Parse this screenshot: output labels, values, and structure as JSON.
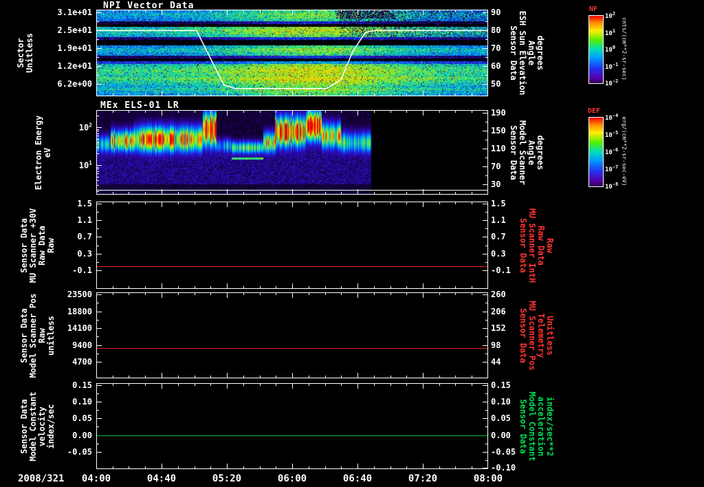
{
  "chart_data": {
    "type": "multi-panel-time-series",
    "time_axis": {
      "date_label": "2008/321",
      "start_hour": 4.0,
      "end_hour": 8.0,
      "tick_labels": [
        "04:00",
        "04:40",
        "05:20",
        "06:00",
        "06:40",
        "07:20",
        "08:00"
      ],
      "tick_hours": [
        4.0,
        4.6667,
        5.3333,
        6.0,
        6.6667,
        7.3333,
        8.0
      ],
      "minor_tick_minutes": 10
    },
    "panels": [
      {
        "id": "npi-vector",
        "type": "heatmap",
        "title": "NPI Vector Data",
        "y_left": {
          "label_lines": [
            "Sector",
            "Unitless"
          ],
          "tick_labels": [
            "3.1e+01",
            "2.5e+01",
            "1.9e+01",
            "1.2e+01",
            "6.2e+00"
          ]
        },
        "y_right": {
          "label_lines": [
            "Sensor Data",
            "ESH Sun Elevation",
            "Angle",
            "degrees"
          ],
          "ticks": [
            90,
            80,
            70,
            60,
            50
          ],
          "vmax": 91.5,
          "vmin": 43.0
        },
        "overlay_line": {
          "name": "sun-elevation-angle",
          "color": "#ffffff",
          "points": [
            [
              4.0,
              80
            ],
            [
              5.02,
              80
            ],
            [
              5.12,
              69
            ],
            [
              5.3,
              49
            ],
            [
              5.42,
              47
            ],
            [
              6.35,
              47
            ],
            [
              6.5,
              52
            ],
            [
              6.62,
              68
            ],
            [
              6.75,
              79
            ],
            [
              6.85,
              80
            ],
            [
              8.0,
              80
            ]
          ]
        },
        "rows_intensity": [
          0.45,
          0.5,
          0.48,
          0.42,
          0.06,
          0,
          0.55,
          0.6,
          0.55,
          0.5,
          0.12,
          0,
          0,
          0.45,
          0.52,
          0.5,
          0.45,
          0.1,
          0,
          0.3,
          0.55,
          0.6,
          0.62,
          0.6,
          0.58,
          0.64,
          0.6,
          0.55,
          0.5,
          0.55,
          0.5,
          0.45
        ],
        "hot_region": {
          "center_frac": 0.55,
          "sigma": 0.17,
          "boost": 0.2
        }
      },
      {
        "id": "els",
        "type": "heatmap",
        "title": "MEx ELS-01 LR",
        "y_left": {
          "label_lines": [
            "Electron Energy",
            "eV"
          ],
          "tick_exponents": [
            2,
            1
          ],
          "log_top": 2.455,
          "log_bottom": 0.218
        },
        "y_right": {
          "label_lines": [
            "Sensor Data",
            "Model Scanner",
            "Angle",
            "degrees"
          ],
          "ticks": [
            190,
            150,
            110,
            70,
            30
          ],
          "vmax": 196,
          "vmin": 7
        },
        "data_end_frac": 0.702,
        "baseline_y_frac": 0.943,
        "segments": [
          [
            0.0,
            0.035,
            0.55,
            0.4,
            0.085
          ],
          [
            0.035,
            0.095,
            0.8,
            0.36,
            0.1
          ],
          [
            0.095,
            0.27,
            0.85,
            0.34,
            0.12
          ],
          [
            0.27,
            0.305,
            1.0,
            0.22,
            0.16
          ],
          [
            0.305,
            0.345,
            0.45,
            0.42,
            0.07
          ],
          [
            0.345,
            0.425,
            0.62,
            0.44,
            0.06,
            0.57
          ],
          [
            0.425,
            0.455,
            0.8,
            0.38,
            0.1
          ],
          [
            0.455,
            0.535,
            0.95,
            0.25,
            0.14
          ],
          [
            0.535,
            0.575,
            1.0,
            0.18,
            0.14
          ],
          [
            0.575,
            0.625,
            0.8,
            0.3,
            0.12
          ],
          [
            0.625,
            0.702,
            0.6,
            0.38,
            0.1
          ]
        ]
      },
      {
        "id": "mu-scanner-30v",
        "type": "line",
        "y_left": {
          "label_lines": [
            "Sensor Data",
            "MU Scanner +30V",
            "Raw Data",
            "Raw"
          ],
          "ticks": [
            1.5,
            1.1,
            0.7,
            0.3,
            -0.1
          ],
          "tick_labels": [
            "1.5",
            "1.1",
            "0.7",
            "0.3",
            "-0.1"
          ],
          "vmax": 1.55,
          "vmin": -0.55
        },
        "y_right": {
          "tick_labels": [
            "1.5",
            "1.1",
            "0.7",
            "0.3",
            "-0.1"
          ]
        },
        "series_label": {
          "lines": [
            "Sensor Data",
            "MU Scanner IntH",
            "Raw Data",
            "Raw"
          ],
          "color": "#ff3333"
        },
        "series": {
          "value": 0.0,
          "color": "#dd2222"
        }
      },
      {
        "id": "model-scanner-pos",
        "type": "line",
        "y_left": {
          "label_lines": [
            "Sensor Data",
            "Model Scanner Pos",
            "Raw",
            "unitless"
          ],
          "ticks": [
            23500,
            18800,
            14100,
            9400,
            4700
          ],
          "tick_labels": [
            "23500",
            "18800",
            "14100",
            "9400",
            "4700"
          ],
          "vmax": 24100,
          "vmin": 100
        },
        "y_right": {
          "tick_labels": [
            "260",
            "206",
            "152",
            "98",
            "44"
          ]
        },
        "series_label": {
          "lines": [
            "Sensor Data",
            "MU Scanner Pos",
            "Telemetry",
            "Unitless"
          ],
          "color": "#ff3333"
        },
        "series": {
          "value": 8500,
          "color": "#dd2222"
        }
      },
      {
        "id": "model-constant-velocity",
        "type": "line",
        "y_left": {
          "label_lines": [
            "Sensor Data",
            "Model Constant",
            "velocity",
            "index/sec"
          ],
          "ticks": [
            0.15,
            0.1,
            0.05,
            0.0,
            -0.05
          ],
          "tick_labels": [
            "0.15",
            "0.10",
            "0.05",
            "0.00",
            "-0.05"
          ],
          "vmax": 0.156,
          "vmin": -0.102
        },
        "y_right": {
          "tick_labels": [
            "0.15",
            "0.10",
            "0.05",
            "0.00",
            "-0.05",
            "-0.10"
          ],
          "tick_values": [
            0.15,
            0.1,
            0.05,
            0.0,
            -0.05,
            -0.1
          ]
        },
        "series_label": {
          "lines": [
            "Sensor Data",
            "Model Constant",
            "acceleration",
            "index/sec**2"
          ],
          "color": "#00dd55"
        },
        "series": {
          "value": 0.0,
          "color": "#00bb44"
        }
      }
    ],
    "colorbars": [
      {
        "label": "NF",
        "exponents": [
          2,
          1,
          0,
          -1,
          -2
        ],
        "units": "cnts/(cm**2-sr-sec)"
      },
      {
        "label": "DEF",
        "exponents": [
          -4,
          -5,
          -6,
          -7,
          -8
        ],
        "units": "erg/(cm**2-sr-sec-eV)"
      }
    ]
  }
}
